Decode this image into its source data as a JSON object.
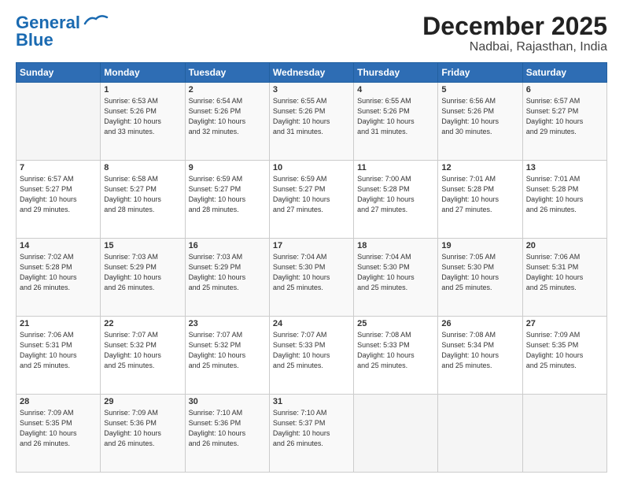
{
  "header": {
    "logo_line1": "General",
    "logo_line2": "Blue",
    "title": "December 2025",
    "subtitle": "Nadbai, Rajasthan, India"
  },
  "weekdays": [
    "Sunday",
    "Monday",
    "Tuesday",
    "Wednesday",
    "Thursday",
    "Friday",
    "Saturday"
  ],
  "weeks": [
    [
      {
        "day": "",
        "info": ""
      },
      {
        "day": "1",
        "info": "Sunrise: 6:53 AM\nSunset: 5:26 PM\nDaylight: 10 hours\nand 33 minutes."
      },
      {
        "day": "2",
        "info": "Sunrise: 6:54 AM\nSunset: 5:26 PM\nDaylight: 10 hours\nand 32 minutes."
      },
      {
        "day": "3",
        "info": "Sunrise: 6:55 AM\nSunset: 5:26 PM\nDaylight: 10 hours\nand 31 minutes."
      },
      {
        "day": "4",
        "info": "Sunrise: 6:55 AM\nSunset: 5:26 PM\nDaylight: 10 hours\nand 31 minutes."
      },
      {
        "day": "5",
        "info": "Sunrise: 6:56 AM\nSunset: 5:26 PM\nDaylight: 10 hours\nand 30 minutes."
      },
      {
        "day": "6",
        "info": "Sunrise: 6:57 AM\nSunset: 5:27 PM\nDaylight: 10 hours\nand 29 minutes."
      }
    ],
    [
      {
        "day": "7",
        "info": "Sunrise: 6:57 AM\nSunset: 5:27 PM\nDaylight: 10 hours\nand 29 minutes."
      },
      {
        "day": "8",
        "info": "Sunrise: 6:58 AM\nSunset: 5:27 PM\nDaylight: 10 hours\nand 28 minutes."
      },
      {
        "day": "9",
        "info": "Sunrise: 6:59 AM\nSunset: 5:27 PM\nDaylight: 10 hours\nand 28 minutes."
      },
      {
        "day": "10",
        "info": "Sunrise: 6:59 AM\nSunset: 5:27 PM\nDaylight: 10 hours\nand 27 minutes."
      },
      {
        "day": "11",
        "info": "Sunrise: 7:00 AM\nSunset: 5:28 PM\nDaylight: 10 hours\nand 27 minutes."
      },
      {
        "day": "12",
        "info": "Sunrise: 7:01 AM\nSunset: 5:28 PM\nDaylight: 10 hours\nand 27 minutes."
      },
      {
        "day": "13",
        "info": "Sunrise: 7:01 AM\nSunset: 5:28 PM\nDaylight: 10 hours\nand 26 minutes."
      }
    ],
    [
      {
        "day": "14",
        "info": "Sunrise: 7:02 AM\nSunset: 5:28 PM\nDaylight: 10 hours\nand 26 minutes."
      },
      {
        "day": "15",
        "info": "Sunrise: 7:03 AM\nSunset: 5:29 PM\nDaylight: 10 hours\nand 26 minutes."
      },
      {
        "day": "16",
        "info": "Sunrise: 7:03 AM\nSunset: 5:29 PM\nDaylight: 10 hours\nand 25 minutes."
      },
      {
        "day": "17",
        "info": "Sunrise: 7:04 AM\nSunset: 5:30 PM\nDaylight: 10 hours\nand 25 minutes."
      },
      {
        "day": "18",
        "info": "Sunrise: 7:04 AM\nSunset: 5:30 PM\nDaylight: 10 hours\nand 25 minutes."
      },
      {
        "day": "19",
        "info": "Sunrise: 7:05 AM\nSunset: 5:30 PM\nDaylight: 10 hours\nand 25 minutes."
      },
      {
        "day": "20",
        "info": "Sunrise: 7:06 AM\nSunset: 5:31 PM\nDaylight: 10 hours\nand 25 minutes."
      }
    ],
    [
      {
        "day": "21",
        "info": "Sunrise: 7:06 AM\nSunset: 5:31 PM\nDaylight: 10 hours\nand 25 minutes."
      },
      {
        "day": "22",
        "info": "Sunrise: 7:07 AM\nSunset: 5:32 PM\nDaylight: 10 hours\nand 25 minutes."
      },
      {
        "day": "23",
        "info": "Sunrise: 7:07 AM\nSunset: 5:32 PM\nDaylight: 10 hours\nand 25 minutes."
      },
      {
        "day": "24",
        "info": "Sunrise: 7:07 AM\nSunset: 5:33 PM\nDaylight: 10 hours\nand 25 minutes."
      },
      {
        "day": "25",
        "info": "Sunrise: 7:08 AM\nSunset: 5:33 PM\nDaylight: 10 hours\nand 25 minutes."
      },
      {
        "day": "26",
        "info": "Sunrise: 7:08 AM\nSunset: 5:34 PM\nDaylight: 10 hours\nand 25 minutes."
      },
      {
        "day": "27",
        "info": "Sunrise: 7:09 AM\nSunset: 5:35 PM\nDaylight: 10 hours\nand 25 minutes."
      }
    ],
    [
      {
        "day": "28",
        "info": "Sunrise: 7:09 AM\nSunset: 5:35 PM\nDaylight: 10 hours\nand 26 minutes."
      },
      {
        "day": "29",
        "info": "Sunrise: 7:09 AM\nSunset: 5:36 PM\nDaylight: 10 hours\nand 26 minutes."
      },
      {
        "day": "30",
        "info": "Sunrise: 7:10 AM\nSunset: 5:36 PM\nDaylight: 10 hours\nand 26 minutes."
      },
      {
        "day": "31",
        "info": "Sunrise: 7:10 AM\nSunset: 5:37 PM\nDaylight: 10 hours\nand 26 minutes."
      },
      {
        "day": "",
        "info": ""
      },
      {
        "day": "",
        "info": ""
      },
      {
        "day": "",
        "info": ""
      }
    ]
  ]
}
